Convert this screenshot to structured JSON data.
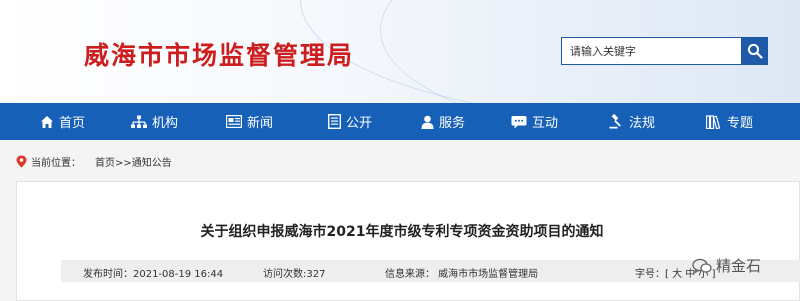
{
  "header": {
    "site_title": "威海市市场监督管理局",
    "search_placeholder": "请输入关键字"
  },
  "nav": {
    "items": [
      {
        "label": "首页",
        "icon": "home-icon"
      },
      {
        "label": "机构",
        "icon": "org-chart-icon"
      },
      {
        "label": "新闻",
        "icon": "news-icon"
      },
      {
        "label": "公开",
        "icon": "document-icon"
      },
      {
        "label": "服务",
        "icon": "user-icon"
      },
      {
        "label": "互动",
        "icon": "chat-icon"
      },
      {
        "label": "法规",
        "icon": "gavel-icon"
      },
      {
        "label": "专题",
        "icon": "books-icon"
      }
    ]
  },
  "breadcrumb": {
    "prefix": "当前位置：",
    "path": "首页>>通知公告"
  },
  "article": {
    "title": "关于组织申报威海市2021年度市级专利专项资金资助项目的通知",
    "publish_time": "发布时间：2021-08-19 16:44",
    "visits": "访问次数:327",
    "source": "信息来源：  威海市市场监督管理局",
    "font_size": "字号：[ 大 中 小 ]"
  },
  "watermark": {
    "text": "精金石"
  },
  "colors": {
    "brand_red": "#cc1e1e",
    "nav_blue": "#1660b8"
  }
}
